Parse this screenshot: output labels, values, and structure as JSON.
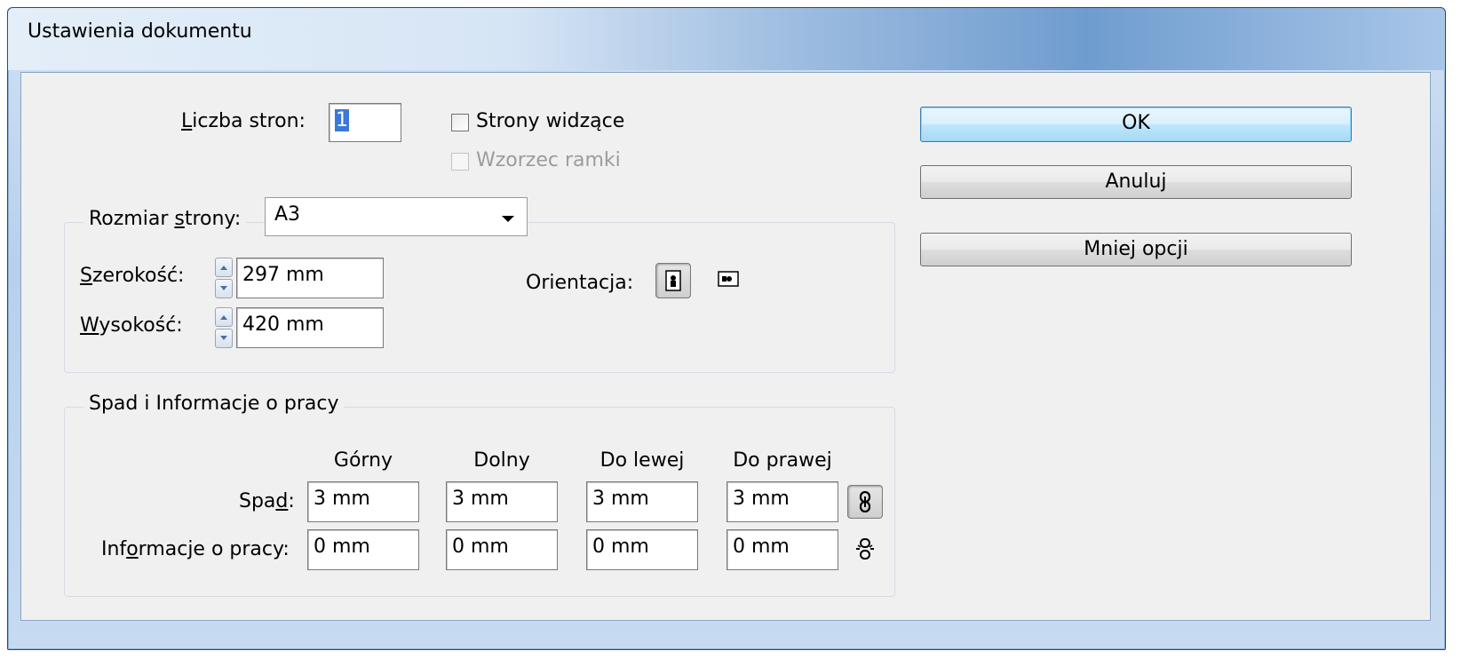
{
  "window": {
    "title": "Ustawienia dokumentu"
  },
  "pages": {
    "label_pre": "",
    "label_u": "L",
    "label_post": "iczba stron:",
    "value": "1"
  },
  "facing_pages": {
    "label": "Strony widzące",
    "checked": false
  },
  "master_frame": {
    "label": "Wzorzec ramki",
    "checked": false,
    "disabled": true
  },
  "page_size": {
    "label_pre": "Rozmiar ",
    "label_u": "s",
    "label_post": "trony:",
    "value": "A3"
  },
  "width": {
    "label_u": "S",
    "label_post": "zerokość:",
    "value": "297 mm"
  },
  "height": {
    "label_u": "W",
    "label_post": "ysokość:",
    "value": "420 mm"
  },
  "orientation": {
    "label": "Orientacja:",
    "selected": "portrait",
    "portrait_icon": "portrait-page-icon",
    "landscape_icon": "landscape-page-icon"
  },
  "bleed_group": {
    "title": "Spad i Informacje o pracy",
    "columns": [
      "Górny",
      "Dolny",
      "Do lewej",
      "Do prawej"
    ],
    "bleed": {
      "label_pre": "Spa",
      "label_u": "d",
      "label_post": ":",
      "values": [
        "3 mm",
        "3 mm",
        "3 mm",
        "3 mm"
      ],
      "link_icon": "chain-link-icon"
    },
    "slug": {
      "label_pre": "Inf",
      "label_u": "o",
      "label_post": "rmacje o pracy:",
      "values": [
        "0 mm",
        "0 mm",
        "0 mm",
        "0 mm"
      ],
      "link_icon": "broken-chain-icon"
    }
  },
  "buttons": {
    "ok": "OK",
    "cancel": "Anuluj",
    "fewer_options": "Mniej opcji"
  },
  "colors": {
    "accent": "#3b78d8",
    "title_gradient_end": "#6f9ccf"
  }
}
